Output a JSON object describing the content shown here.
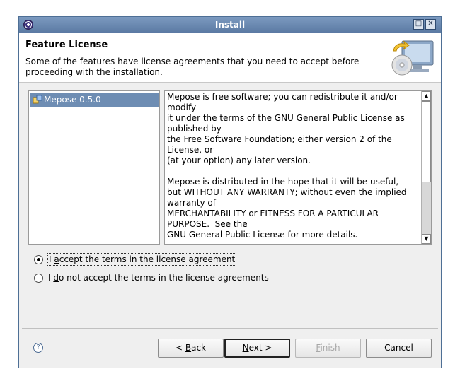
{
  "window": {
    "title": "Install"
  },
  "header": {
    "title": "Feature License",
    "description": "Some of the features have license agreements that you need to accept before proceeding with the installation."
  },
  "features": [
    {
      "label": "Mepose 0.5.0",
      "icon": "plugin-icon",
      "selected": true
    }
  ],
  "license": {
    "text": "Mepose is free software; you can redistribute it and/or\nmodify\nit under the terms of the GNU General Public License as\npublished by\nthe Free Software Foundation; either version 2 of the\nLicense, or\n(at your option) any later version.\n\nMepose is distributed in the hope that it will be useful,\nbut WITHOUT ANY WARRANTY; without even the implied\nwarranty of\nMERCHANTABILITY or FITNESS FOR A PARTICULAR\nPURPOSE.  See the\nGNU General Public License for more details."
  },
  "options": {
    "accept": {
      "pre": "I ",
      "mnemonic": "a",
      "post": "ccept the terms in the license agreement",
      "checked": true
    },
    "decline": {
      "pre": "I ",
      "mnemonic": "d",
      "post": "o not accept the terms in the license agreements",
      "checked": false
    }
  },
  "buttons": {
    "back": {
      "pre": "< ",
      "mnemonic": "B",
      "post": "ack"
    },
    "next": {
      "pre": "",
      "mnemonic": "N",
      "post": "ext >"
    },
    "finish": {
      "pre": "",
      "mnemonic": "F",
      "post": "inish",
      "disabled": true
    },
    "cancel": {
      "label": "Cancel"
    }
  },
  "colors": {
    "titlebar": "#5b7aa3",
    "selection": "#6e8db3"
  }
}
